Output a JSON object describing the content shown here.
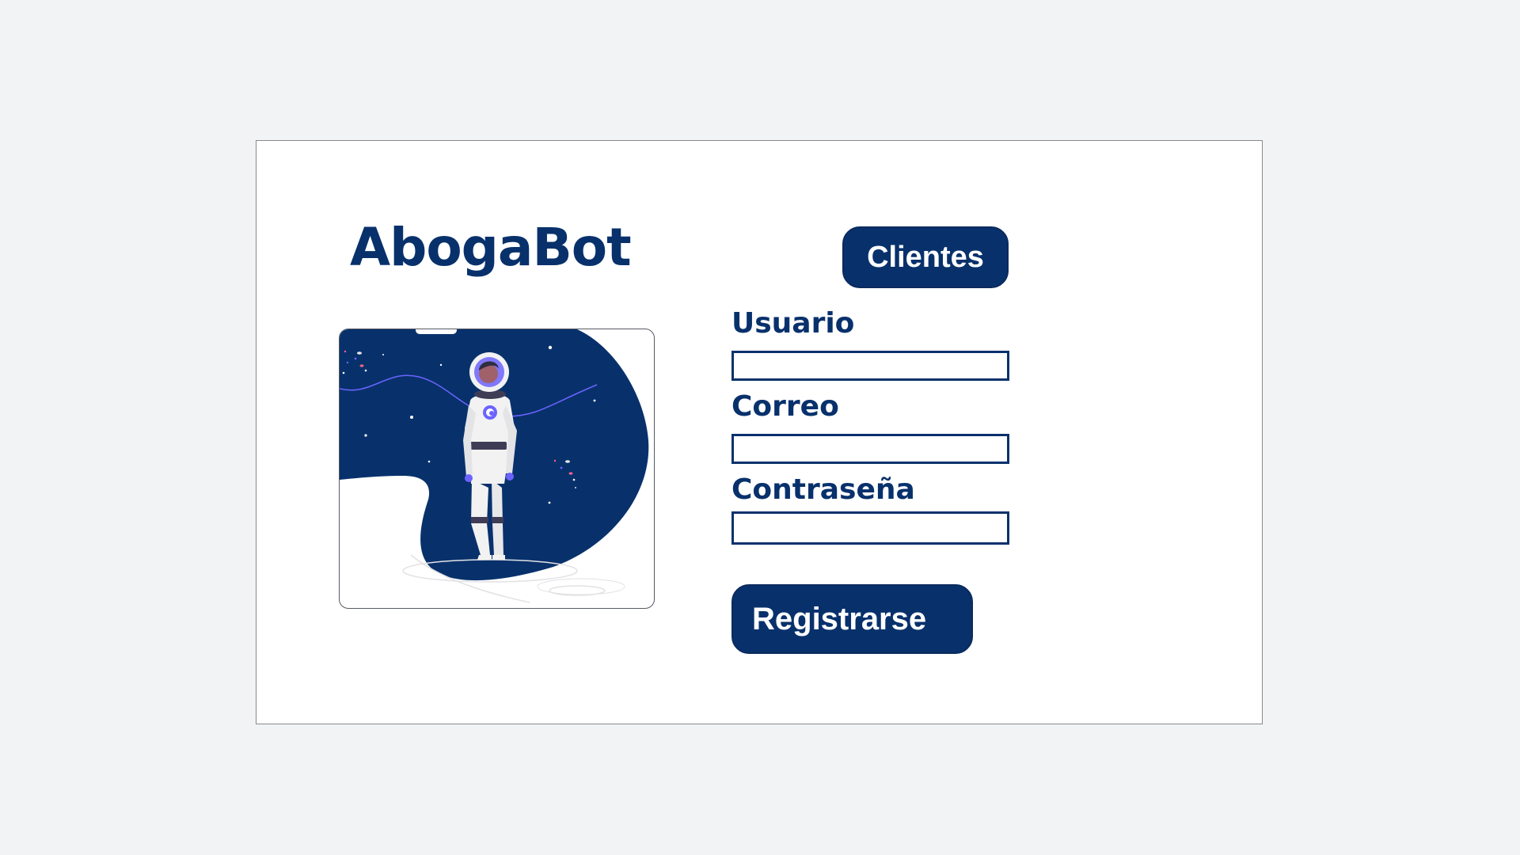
{
  "brand": {
    "title": "AbogaBot"
  },
  "nav": {
    "clients_label": "Clientes"
  },
  "form": {
    "fields": [
      {
        "label": "Usuario",
        "value": "",
        "placeholder": ""
      },
      {
        "label": "Correo",
        "value": "",
        "placeholder": ""
      },
      {
        "label": "Contraseña",
        "value": "",
        "placeholder": ""
      }
    ],
    "submit_label": "Registrarse"
  },
  "illustration": {
    "icon": "astronaut-illustration"
  },
  "colors": {
    "brand": "#08316c",
    "background": "#f2f3f5",
    "card": "#ffffff",
    "accent": "#6c63ff"
  }
}
